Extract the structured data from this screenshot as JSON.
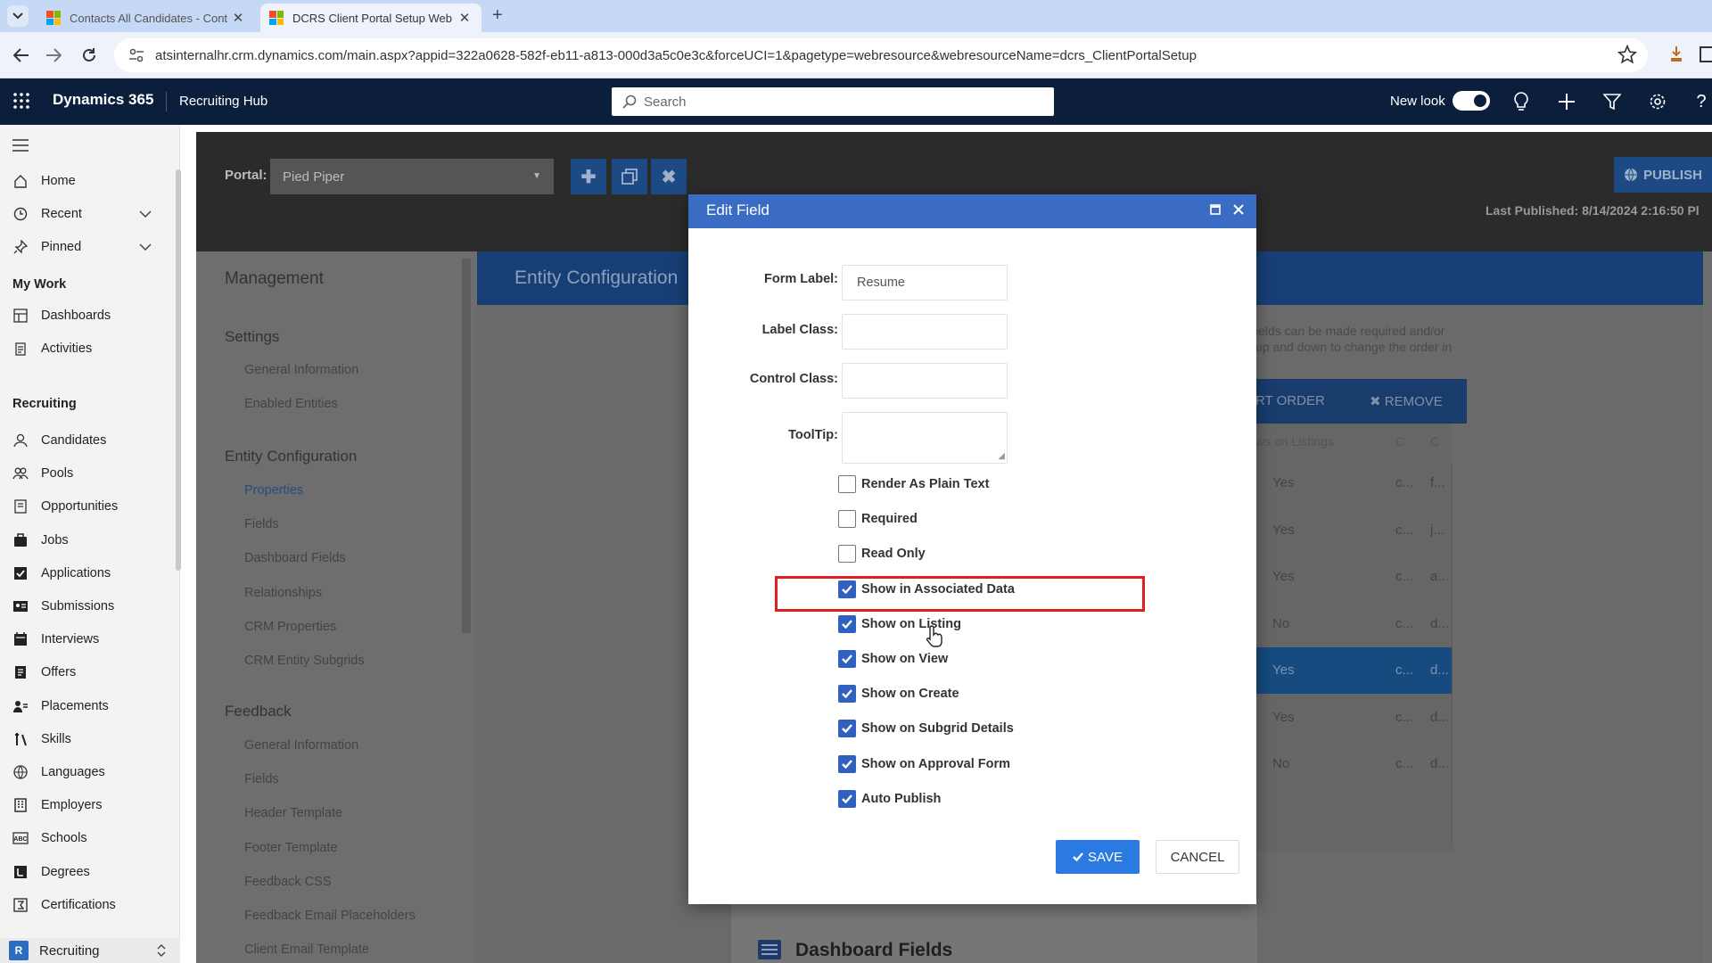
{
  "browser": {
    "tabs": [
      {
        "title": "Contacts All Candidates - Cont",
        "active": false
      },
      {
        "title": "DCRS Client Portal Setup Web",
        "active": true
      }
    ],
    "new_tab": "+",
    "url": "atsinternalhr.crm.dynamics.com/main.aspx?appid=322a0628-582f-eb11-a813-000d3a5c0e3c&forceUCI=1&pagetype=webresource&webresourceName=dcrs_ClientPortalSetup"
  },
  "header": {
    "brand": "Dynamics 365",
    "app_name": "Recruiting Hub",
    "search_placeholder": "Search",
    "new_look_label": "New look",
    "new_look_on": true,
    "icons": [
      "lightbulb-icon",
      "plus-icon",
      "filter-icon",
      "gear-icon",
      "help-icon"
    ]
  },
  "sidebar": {
    "top_items": [
      {
        "label": "Home",
        "icon": "home-icon"
      },
      {
        "label": "Recent",
        "icon": "clock-icon",
        "expandable": true
      },
      {
        "label": "Pinned",
        "icon": "pin-icon",
        "expandable": true
      }
    ],
    "my_work_title": "My Work",
    "my_work_items": [
      {
        "label": "Dashboards",
        "icon": "dashboard-icon"
      },
      {
        "label": "Activities",
        "icon": "clipboard-icon"
      }
    ],
    "recruiting_title": "Recruiting",
    "recruiting_items": [
      {
        "label": "Candidates",
        "icon": "person-icon"
      },
      {
        "label": "Pools",
        "icon": "group-icon"
      },
      {
        "label": "Opportunities",
        "icon": "document-icon"
      },
      {
        "label": "Jobs",
        "icon": "briefcase-icon"
      },
      {
        "label": "Applications",
        "icon": "checklist-icon"
      },
      {
        "label": "Submissions",
        "icon": "id-card-icon"
      },
      {
        "label": "Interviews",
        "icon": "calendar-icon"
      },
      {
        "label": "Offers",
        "icon": "offer-icon"
      },
      {
        "label": "Placements",
        "icon": "placement-icon"
      },
      {
        "label": "Skills",
        "icon": "tools-icon"
      },
      {
        "label": "Languages",
        "icon": "globe-icon"
      },
      {
        "label": "Employers",
        "icon": "building-icon"
      },
      {
        "label": "Schools",
        "icon": "abc-icon"
      },
      {
        "label": "Degrees",
        "icon": "degree-icon"
      },
      {
        "label": "Certifications",
        "icon": "certificate-icon"
      }
    ],
    "area": {
      "badge": "R",
      "label": "Recruiting"
    }
  },
  "portal_bar": {
    "portal_label": "Portal:",
    "portal_value": "Pied Piper",
    "publish_label": "PUBLISH",
    "last_published": "Last Published: 8/14/2024 2:16:50 Pl"
  },
  "management": {
    "title": "Management",
    "sections": [
      {
        "title": "Settings",
        "items": [
          "General Information",
          "Enabled Entities"
        ]
      },
      {
        "title": "Entity Configuration",
        "items": [
          "Properties",
          "Fields",
          "Dashboard Fields",
          "Relationships",
          "CRM Properties",
          "CRM Entity Subgrids"
        ]
      },
      {
        "title": "Feedback",
        "items": [
          "General Information",
          "Fields",
          "Header Template",
          "Footer Template",
          "Feedback CSS",
          "Feedback Email Placeholders",
          "Client Email Template"
        ]
      }
    ],
    "selected_item": "Properties"
  },
  "entity_config": {
    "title": "Entity Configuration",
    "help_line1": "ields can be made required and/or",
    "help_line2": "up and down to change the order in",
    "toolbar_sort": "RT ORDER",
    "toolbar_remove": "✖ REMOVE",
    "grid_header": [
      "ws on Listings",
      "C",
      "C"
    ],
    "grid_rows": [
      {
        "listing": "Yes",
        "c1": "c...",
        "c2": "f...",
        "selected": false
      },
      {
        "listing": "Yes",
        "c1": "c...",
        "c2": "j...",
        "selected": false
      },
      {
        "listing": "Yes",
        "c1": "c...",
        "c2": "a...",
        "selected": false
      },
      {
        "listing": "No",
        "c1": "c...",
        "c2": "d...",
        "selected": false
      },
      {
        "listing": "Yes",
        "c1": "c...",
        "c2": "d...",
        "selected": true
      },
      {
        "listing": "Yes",
        "c1": "c...",
        "c2": "d...",
        "selected": false
      },
      {
        "listing": "No",
        "c1": "c...",
        "c2": "d...",
        "selected": false
      }
    ],
    "dashboard_section": "Dashboard Fields"
  },
  "modal": {
    "title": "Edit Field",
    "fields": [
      {
        "label": "Form Label:",
        "value": "Resume"
      },
      {
        "label": "Label Class:",
        "value": ""
      },
      {
        "label": "Control Class:",
        "value": ""
      },
      {
        "label": "ToolTip:",
        "value": ""
      }
    ],
    "checkboxes": [
      {
        "label": "Render As Plain Text",
        "checked": false
      },
      {
        "label": "Required",
        "checked": false
      },
      {
        "label": "Read Only",
        "checked": false
      },
      {
        "label": "Show in Associated Data",
        "checked": true
      },
      {
        "label": "Show on Listing",
        "checked": true
      },
      {
        "label": "Show on View",
        "checked": true
      },
      {
        "label": "Show on Create",
        "checked": true
      },
      {
        "label": "Show on Subgrid Details",
        "checked": true
      },
      {
        "label": "Show on Approval Form",
        "checked": true
      },
      {
        "label": "Auto Publish",
        "checked": true
      }
    ],
    "save_label": "SAVE",
    "cancel_label": "CANCEL"
  },
  "colors": {
    "header_bg": "#0b1f3d",
    "modal_header": "#3a6cc4",
    "checkbox_checked": "#3060c0",
    "save_button": "#2a7ae2",
    "highlight_border": "#e02020"
  }
}
